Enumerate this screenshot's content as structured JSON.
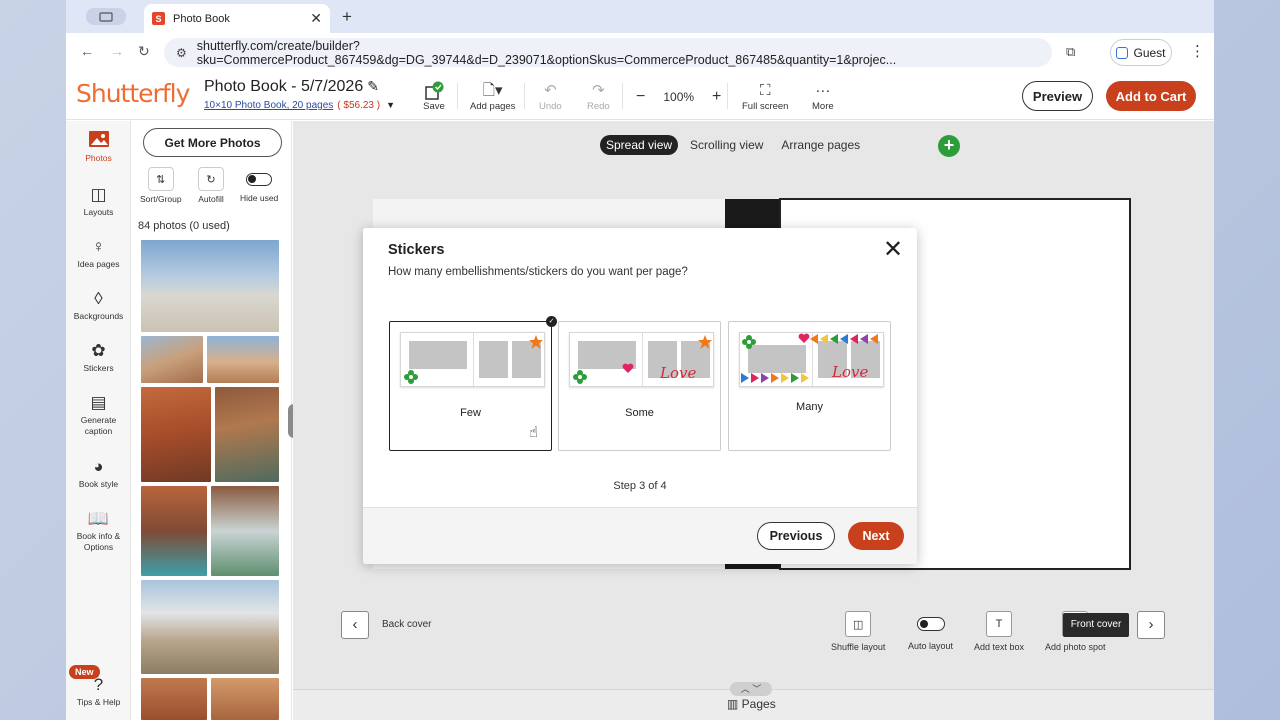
{
  "browser": {
    "tab_title": "Photo Book",
    "favicon_letter": "S",
    "url": "shutterfly.com/create/builder?sku=CommerceProduct_867459&dg=DG_39744&d=D_239071&optionSkus=CommerceProduct_867485&quantity=1&projec...",
    "profile_label": "Guest"
  },
  "header": {
    "logo": "Shutterfly",
    "title": "Photo Book - 5/7/2026",
    "subtitle": "10×10 Photo Book, 20 pages",
    "price": "( $56.23 )",
    "tools": {
      "save": "Save",
      "add_pages": "Add pages",
      "undo": "Undo",
      "redo": "Redo",
      "zoom": "100%",
      "full_screen": "Full screen",
      "more": "More"
    },
    "preview_label": "Preview",
    "cart_label": "Add to Cart",
    "accent_color": "#c8401c",
    "logo_color": "#ef6c33"
  },
  "left_rail": {
    "photos": "Photos",
    "layouts": "Layouts",
    "idea_pages": "Idea pages",
    "backgrounds": "Backgrounds",
    "stickers": "Stickers",
    "generate_caption_1": "Generate",
    "generate_caption_2": "caption",
    "book_style": "Book style",
    "book_info_1": "Book info &",
    "book_info_2": "Options",
    "new_badge": "New",
    "tips_help": "Tips & Help"
  },
  "photo_panel": {
    "get_more": "Get More Photos",
    "sort_group": "Sort/Group",
    "autofill": "Autofill",
    "hide_used": "Hide used",
    "count": "84 photos (0 used)"
  },
  "canvas": {
    "views": [
      "Spread view",
      "Scrolling view",
      "Arrange pages"
    ],
    "back_cover": "Back cover",
    "front_cover": "Front cover",
    "tools": [
      "Shuffle layout",
      "Auto layout",
      "Add text box",
      "Add photo spot"
    ],
    "pages": "Pages"
  },
  "modal": {
    "title": "Stickers",
    "question": "How many embellishments/stickers do you want per page?",
    "options": [
      "Few",
      "Some",
      "Many"
    ],
    "selected": "Few",
    "mini_text": "Love",
    "step": "Step 3 of 4",
    "previous": "Previous",
    "next": "Next"
  }
}
